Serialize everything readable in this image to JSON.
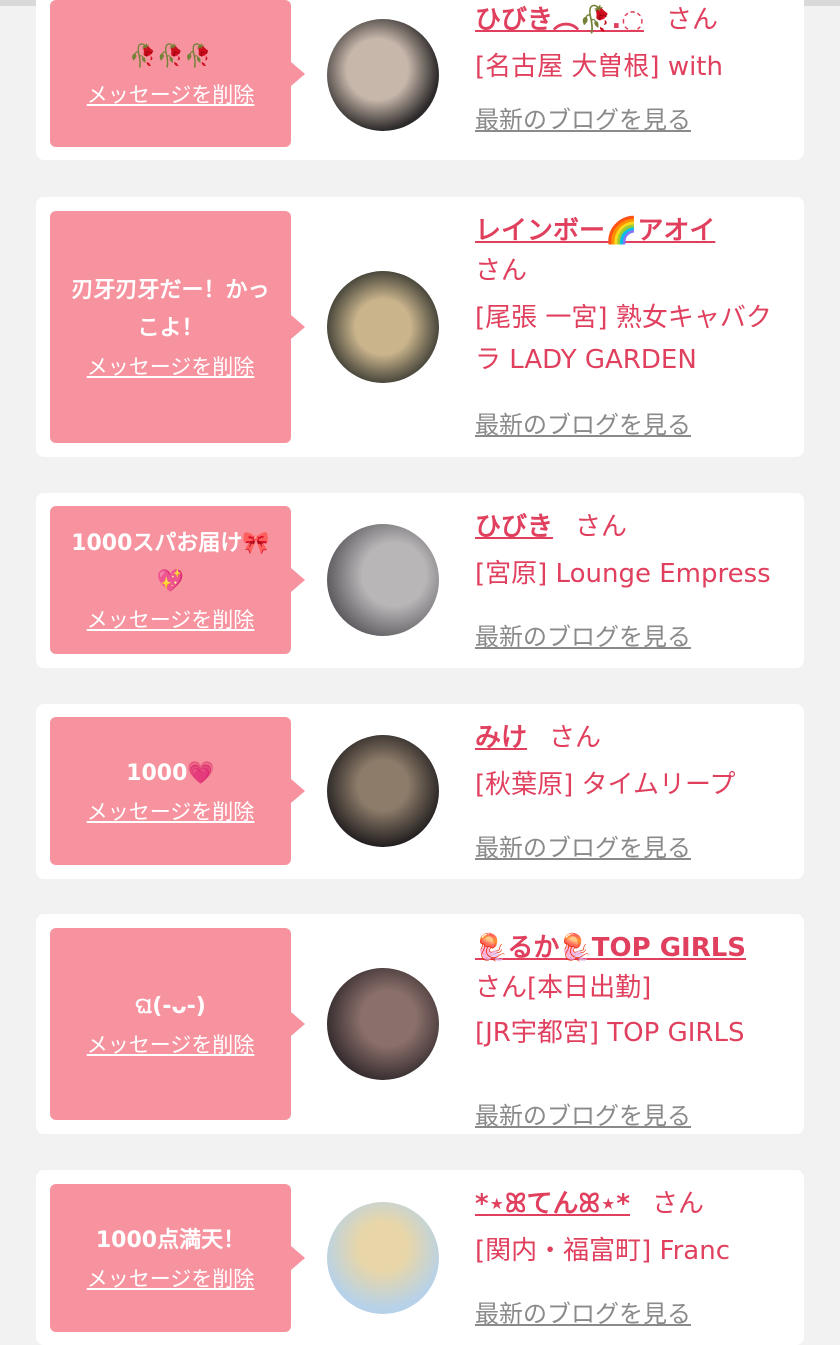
{
  "delete_label": "メッセージを削除",
  "blog_label": "最新のブログを見る",
  "san_label": "さん",
  "items": [
    {
      "message": "🥀🥀🥀",
      "name": "ひびき︵🥀.◌",
      "shop": "[名古屋 大曽根] with",
      "avatar_colors": [
        "#c7b7ab",
        "#2d2a2a"
      ]
    },
    {
      "message": "刃牙刃牙だー！かっこよ！",
      "name": "レインボー🌈アオイ",
      "shop": "[尾張 一宮] 熟女キャバクラ LADY GARDEN",
      "avatar_colors": [
        "#c9b48c",
        "#3a3a32"
      ]
    },
    {
      "message": "1000スパお届け🎀💖",
      "name": "ひびき",
      "shop": "[宮原] Lounge Empress",
      "avatar_colors": [
        "#b9b6b8",
        "#5c5a5e"
      ]
    },
    {
      "message": "1000💗",
      "name": "みけ",
      "shop": "[秋葉原] タイムリープ",
      "avatar_colors": [
        "#8d7c6a",
        "#1e1b1c"
      ]
    },
    {
      "message": "ଘ(-ᴗ-)",
      "name": "🪼るか🪼TOP GIRLS",
      "shop_line1": "[本日出勤]",
      "shop": "[JR宇都宮] TOP GIRLS",
      "avatar_colors": [
        "#8a6f6a",
        "#2a2326"
      ]
    },
    {
      "message": "1000点満天！",
      "name": "*⋆ꕤてんꕤ⋆*",
      "shop": "[関内・福富町] Franc",
      "avatar_colors": [
        "#b7d2e8",
        "#e8d6a8"
      ]
    }
  ]
}
